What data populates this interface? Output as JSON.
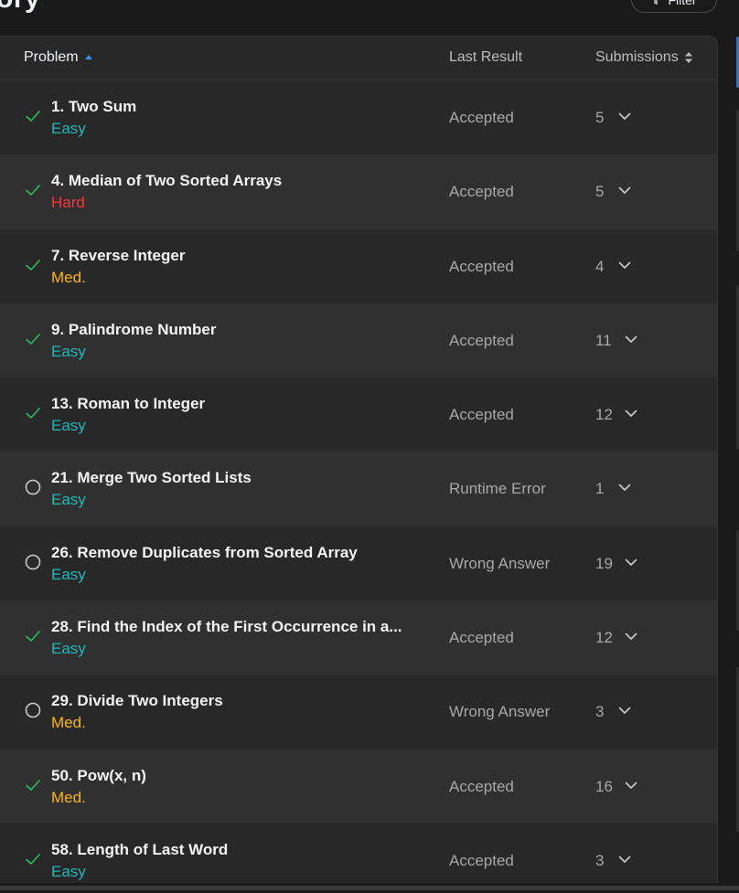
{
  "page": {
    "title": "ory",
    "filter_label": "Filter"
  },
  "table": {
    "headers": {
      "problem": "Problem",
      "last_result": "Last Result",
      "submissions": "Submissions"
    },
    "rows": [
      {
        "title": "1. Two Sum",
        "difficulty": "Easy",
        "status": "solved",
        "result": "Accepted",
        "submissions": "5"
      },
      {
        "title": "4. Median of Two Sorted Arrays",
        "difficulty": "Hard",
        "status": "solved",
        "result": "Accepted",
        "submissions": "5"
      },
      {
        "title": "7. Reverse Integer",
        "difficulty": "Med.",
        "status": "solved",
        "result": "Accepted",
        "submissions": "4"
      },
      {
        "title": "9. Palindrome Number",
        "difficulty": "Easy",
        "status": "solved",
        "result": "Accepted",
        "submissions": "11"
      },
      {
        "title": "13. Roman to Integer",
        "difficulty": "Easy",
        "status": "solved",
        "result": "Accepted",
        "submissions": "12"
      },
      {
        "title": "21. Merge Two Sorted Lists",
        "difficulty": "Easy",
        "status": "attempted",
        "result": "Runtime Error",
        "submissions": "1"
      },
      {
        "title": "26. Remove Duplicates from Sorted Array",
        "difficulty": "Easy",
        "status": "attempted",
        "result": "Wrong Answer",
        "submissions": "19"
      },
      {
        "title": "28. Find the Index of the First Occurrence in a...",
        "difficulty": "Easy",
        "status": "solved",
        "result": "Accepted",
        "submissions": "12"
      },
      {
        "title": "29. Divide Two Integers",
        "difficulty": "Med.",
        "status": "attempted",
        "result": "Wrong Answer",
        "submissions": "3"
      },
      {
        "title": "50. Pow(x, n)",
        "difficulty": "Med.",
        "status": "solved",
        "result": "Accepted",
        "submissions": "16"
      },
      {
        "title": "58. Length of Last Word",
        "difficulty": "Easy",
        "status": "solved",
        "result": "Accepted",
        "submissions": "3"
      }
    ]
  },
  "colors": {
    "easy": "#1cb8b8",
    "medium": "#ffb800",
    "hard": "#f63737",
    "check": "#2cbb5d",
    "accent": "#2f6fcc"
  }
}
